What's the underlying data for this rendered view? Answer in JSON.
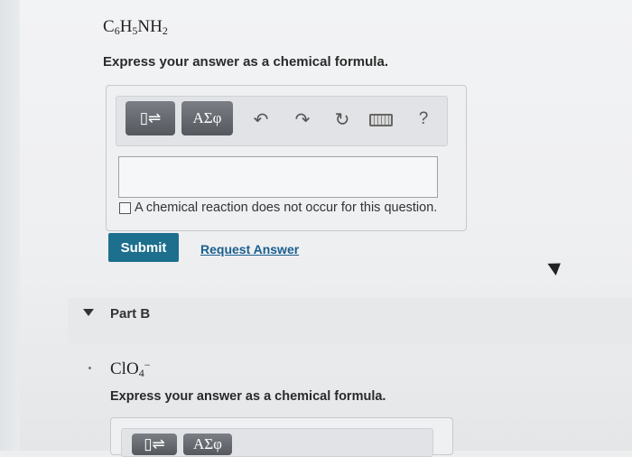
{
  "partA": {
    "formula": {
      "p1": "C",
      "s1": "6",
      "p2": "H",
      "s2": "5",
      "p3": "NH",
      "s3": "2"
    },
    "instruction": "Express your answer as a chemical formula.",
    "toolbar": {
      "templates_label": "▯⇌",
      "greek_label": "ΑΣφ",
      "undo": "↶",
      "redo": "↷",
      "reset": "↻",
      "help": "?"
    },
    "answer_value": "",
    "no_reaction_label": "A chemical reaction does not occur for this question.",
    "submit_label": "Submit",
    "request_label": "Request Answer"
  },
  "partB": {
    "title": "Part B",
    "formula": {
      "p1": "ClO",
      "s1": "4",
      "sup": "−"
    },
    "instruction": "Express your answer as a chemical formula.",
    "toolbar": {
      "templates_label": "▯⇌",
      "greek_label": "ΑΣφ"
    }
  }
}
